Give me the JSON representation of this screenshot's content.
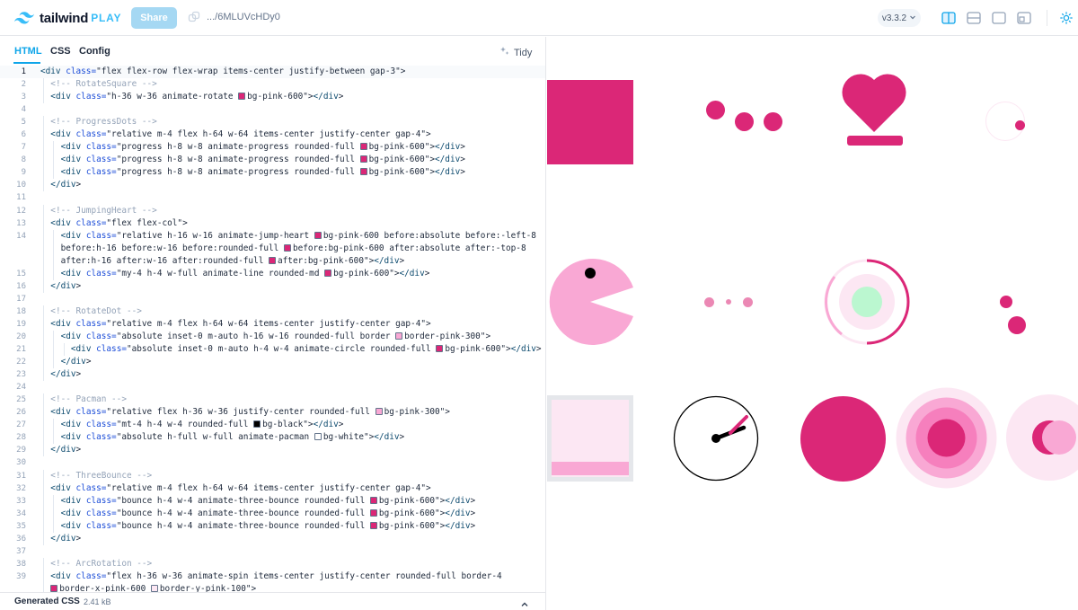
{
  "header": {
    "logo_text": "tailwind",
    "logo_accent": "PLAY",
    "share_label": "Share",
    "share_url": ".../6MLUVcHDy0",
    "version": "v3.3.2"
  },
  "editor": {
    "tabs": [
      "HTML",
      "CSS",
      "Config"
    ],
    "active_tab": "HTML",
    "tidy_label": "Tidy",
    "generated_css_label": "Generated CSS",
    "generated_css_size": "2.41 kB"
  },
  "code": [
    {
      "n": "1",
      "indent": 0,
      "t": "<div class=\"flex flex-row flex-wrap items-center justify-between gap-3\">"
    },
    {
      "n": "2",
      "indent": 1,
      "t": "<!-- RotateSquare -->"
    },
    {
      "n": "3",
      "indent": 1,
      "t": "<div class=\"h-36 w-36 animate-rotate ■bg-pink-600\"></div>"
    },
    {
      "n": "4",
      "indent": 0,
      "t": ""
    },
    {
      "n": "5",
      "indent": 1,
      "t": "<!-- ProgressDots -->"
    },
    {
      "n": "6",
      "indent": 1,
      "t": "<div class=\"relative m-4 flex h-64 w-64 items-center justify-center gap-4\">"
    },
    {
      "n": "7",
      "indent": 2,
      "t": "<div class=\"progress h-8 w-8 animate-progress rounded-full ■bg-pink-600\"></div>"
    },
    {
      "n": "8",
      "indent": 2,
      "t": "<div class=\"progress h-8 w-8 animate-progress rounded-full ■bg-pink-600\"></div>"
    },
    {
      "n": "9",
      "indent": 2,
      "t": "<div class=\"progress h-8 w-8 animate-progress rounded-full ■bg-pink-600\"></div>"
    },
    {
      "n": "10",
      "indent": 1,
      "t": "</div>"
    },
    {
      "n": "11",
      "indent": 0,
      "t": ""
    },
    {
      "n": "12",
      "indent": 1,
      "t": "<!-- JumpingHeart -->"
    },
    {
      "n": "13",
      "indent": 1,
      "t": "<div class=\"flex flex-col\">"
    },
    {
      "n": "14",
      "indent": 2,
      "t": "<div class=\"relative h-16 w-16 animate-jump-heart ■bg-pink-600 before:absolute before:-left-8"
    },
    {
      "n": "",
      "indent": 2,
      "t": "before:h-16 before:w-16 before:rounded-full ■before:bg-pink-600 after:absolute after:-top-8"
    },
    {
      "n": "",
      "indent": 2,
      "t": "after:h-16 after:w-16 after:rounded-full ■after:bg-pink-600\"></div>"
    },
    {
      "n": "15",
      "indent": 2,
      "t": "<div class=\"my-4 h-4 w-full animate-line rounded-md ■bg-pink-600\"></div>"
    },
    {
      "n": "16",
      "indent": 1,
      "t": "</div>"
    },
    {
      "n": "17",
      "indent": 0,
      "t": ""
    },
    {
      "n": "18",
      "indent": 1,
      "t": "<!-- RotateDot -->"
    },
    {
      "n": "19",
      "indent": 1,
      "t": "<div class=\"relative m-4 flex h-64 w-64 items-center justify-center gap-4\">"
    },
    {
      "n": "20",
      "indent": 2,
      "t": "<div class=\"absolute inset-0 m-auto h-16 w-16 rounded-full border □border-pink-300\">"
    },
    {
      "n": "21",
      "indent": 3,
      "t": "<div class=\"absolute inset-0 m-auto h-4 w-4 animate-circle rounded-full ■bg-pink-600\"></div>"
    },
    {
      "n": "22",
      "indent": 2,
      "t": "</div>"
    },
    {
      "n": "23",
      "indent": 1,
      "t": "</div>"
    },
    {
      "n": "24",
      "indent": 0,
      "t": ""
    },
    {
      "n": "25",
      "indent": 1,
      "t": "<!-- Pacman -->"
    },
    {
      "n": "26",
      "indent": 1,
      "t": "<div class=\"relative flex h-36 w-36 justify-center rounded-full □bg-pink-300\">"
    },
    {
      "n": "27",
      "indent": 2,
      "t": "<div class=\"mt-4 h-4 w-4 rounded-full ■bg-black\"></div>"
    },
    {
      "n": "28",
      "indent": 2,
      "t": "<div class=\"absolute h-full w-full animate-pacman □bg-white\"></div>"
    },
    {
      "n": "29",
      "indent": 1,
      "t": "</div>"
    },
    {
      "n": "30",
      "indent": 0,
      "t": ""
    },
    {
      "n": "31",
      "indent": 1,
      "t": "<!-- ThreeBounce -->"
    },
    {
      "n": "32",
      "indent": 1,
      "t": "<div class=\"relative m-4 flex h-64 w-64 items-center justify-center gap-4\">"
    },
    {
      "n": "33",
      "indent": 2,
      "t": "<div class=\"bounce h-4 w-4 animate-three-bounce rounded-full ■bg-pink-600\"></div>"
    },
    {
      "n": "34",
      "indent": 2,
      "t": "<div class=\"bounce h-4 w-4 animate-three-bounce rounded-full ■bg-pink-600\"></div>"
    },
    {
      "n": "35",
      "indent": 2,
      "t": "<div class=\"bounce h-4 w-4 animate-three-bounce rounded-full ■bg-pink-600\"></div>"
    },
    {
      "n": "36",
      "indent": 1,
      "t": "</div>"
    },
    {
      "n": "37",
      "indent": 0,
      "t": ""
    },
    {
      "n": "38",
      "indent": 1,
      "t": "<!-- ArcRotation -->"
    },
    {
      "n": "39",
      "indent": 1,
      "t": "<div class=\"flex h-36 w-36 animate-spin items-center justify-center rounded-full border-4"
    },
    {
      "n": "",
      "indent": 1,
      "t": "■border-x-pink-600 □border-y-pink-100\">"
    }
  ],
  "colors": {
    "accent": "#0ea5e9",
    "pink600": "#db2777",
    "pink300": "#f9a8d4",
    "pink100": "#fce7f3",
    "green": "#bbf7d0"
  },
  "icons": [
    "tailwind-logo-icon",
    "copy-link-icon",
    "chevron-down-icon",
    "split-vertical-icon",
    "split-horizontal-icon",
    "preview-only-icon",
    "editor-only-icon",
    "theme-sun-icon",
    "sparkle-icon",
    "chevron-up-icon"
  ]
}
